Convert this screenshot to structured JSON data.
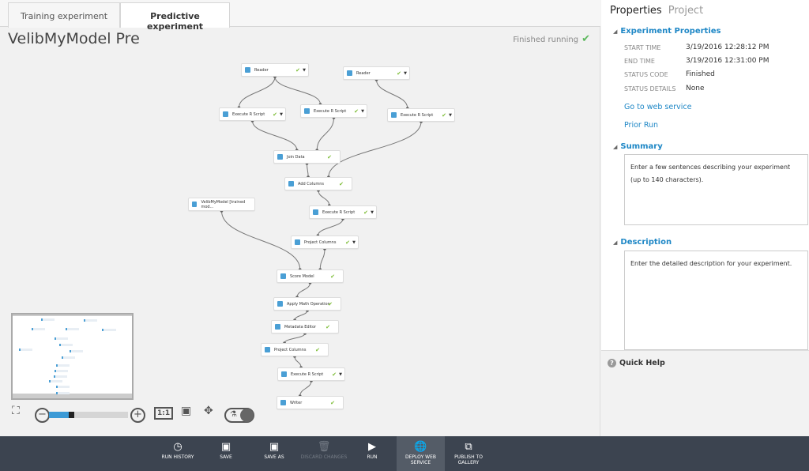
{
  "tabs": [
    {
      "label": "Training experiment",
      "active": false
    },
    {
      "label": "Predictive experiment",
      "active": true
    }
  ],
  "experiment": {
    "title": "VelibMyModel Pre",
    "status": "Finished running",
    "status_icon": "check-icon",
    "status_color": "#5cb85c"
  },
  "nodes": [
    {
      "label": "Reader",
      "check": true,
      "dropdown": true
    },
    {
      "label": "Reader",
      "check": true,
      "dropdown": true
    },
    {
      "label": "Execute R Script",
      "check": true,
      "dropdown": true
    },
    {
      "label": "Execute R Script",
      "check": true,
      "dropdown": true
    },
    {
      "label": "Execute R Script",
      "check": true,
      "dropdown": true
    },
    {
      "label": "Join Data",
      "check": true,
      "dropdown": false
    },
    {
      "label": "Add Columns",
      "check": true,
      "dropdown": false
    },
    {
      "label": "VelibMyModel [trained mod...",
      "check": false,
      "dropdown": false
    },
    {
      "label": "Execute R Script",
      "check": true,
      "dropdown": true
    },
    {
      "label": "Project Columns",
      "check": true,
      "dropdown": true
    },
    {
      "label": "Score Model",
      "check": true,
      "dropdown": false
    },
    {
      "label": "Apply Math Operation",
      "check": true,
      "dropdown": false
    },
    {
      "label": "Metadata Editor",
      "check": true,
      "dropdown": false
    },
    {
      "label": "Project Columns",
      "check": true,
      "dropdown": false
    },
    {
      "label": "Execute R Script",
      "check": true,
      "dropdown": true
    },
    {
      "label": "Writer",
      "check": true,
      "dropdown": false
    }
  ],
  "zoom_controls": {
    "actual_size_label": "1:1",
    "zoom_level_fraction": 0.25
  },
  "properties": {
    "tabs": {
      "properties": "Properties",
      "project": "Project"
    },
    "experiment_properties_heading": "Experiment Properties",
    "rows": [
      {
        "label": "START TIME",
        "value": "3/19/2016 12:28:12 PM"
      },
      {
        "label": "END TIME",
        "value": "3/19/2016 12:31:00 PM"
      },
      {
        "label": "STATUS CODE",
        "value": "Finished"
      },
      {
        "label": "STATUS DETAILS",
        "value": "None"
      }
    ],
    "go_to_web_service": "Go to web service",
    "prior_run": "Prior Run",
    "summary_heading": "Summary",
    "summary_placeholder": "Enter a few sentences describing your experiment (up to 140 characters).",
    "description_heading": "Description",
    "description_placeholder": "Enter the detailed description for your experiment.",
    "quick_help": "Quick Help"
  },
  "toolbar": {
    "run_history": "RUN HISTORY",
    "save": "SAVE",
    "save_as": "SAVE AS",
    "discard_changes": "DISCARD CHANGES",
    "run": "RUN",
    "deploy_web_service": "DEPLOY WEB SERVICE",
    "publish_to_gallery": "PUBLISH TO GALLERY"
  }
}
